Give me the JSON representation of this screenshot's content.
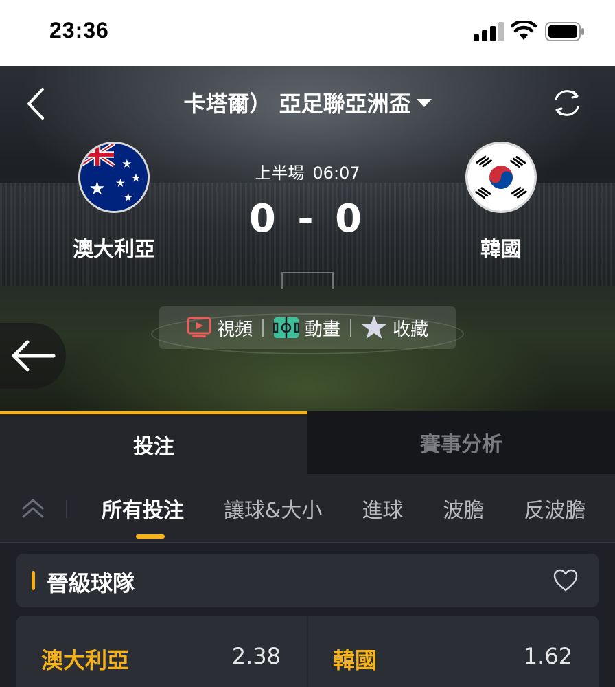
{
  "status_bar": {
    "time": "23:36"
  },
  "header": {
    "league": "卡塔爾）  亞足聯亞洲盃",
    "period": "上半場",
    "clock": "06:07",
    "score": "0 - 0",
    "home_team": "澳大利亞",
    "away_team": "韓國"
  },
  "media": {
    "video": "視頻",
    "animation": "動畫",
    "favorite": "收藏"
  },
  "tabs": [
    {
      "label": "投注",
      "active": true
    },
    {
      "label": "賽事分析",
      "active": false
    }
  ],
  "subnav": {
    "items": [
      {
        "label": "所有投注",
        "active": true
      },
      {
        "label": "讓球&大小",
        "active": false
      },
      {
        "label": "進球",
        "active": false
      },
      {
        "label": "波膽",
        "active": false
      },
      {
        "label": "反波膽",
        "active": false
      }
    ]
  },
  "market": {
    "title": "晉級球隊",
    "selections": [
      {
        "name": "澳大利亞",
        "price": "2.38"
      },
      {
        "name": "韓國",
        "price": "1.62"
      }
    ]
  },
  "colors": {
    "accent": "#f5b21a",
    "background": "#1e2026",
    "panel": "#2c2e35"
  }
}
